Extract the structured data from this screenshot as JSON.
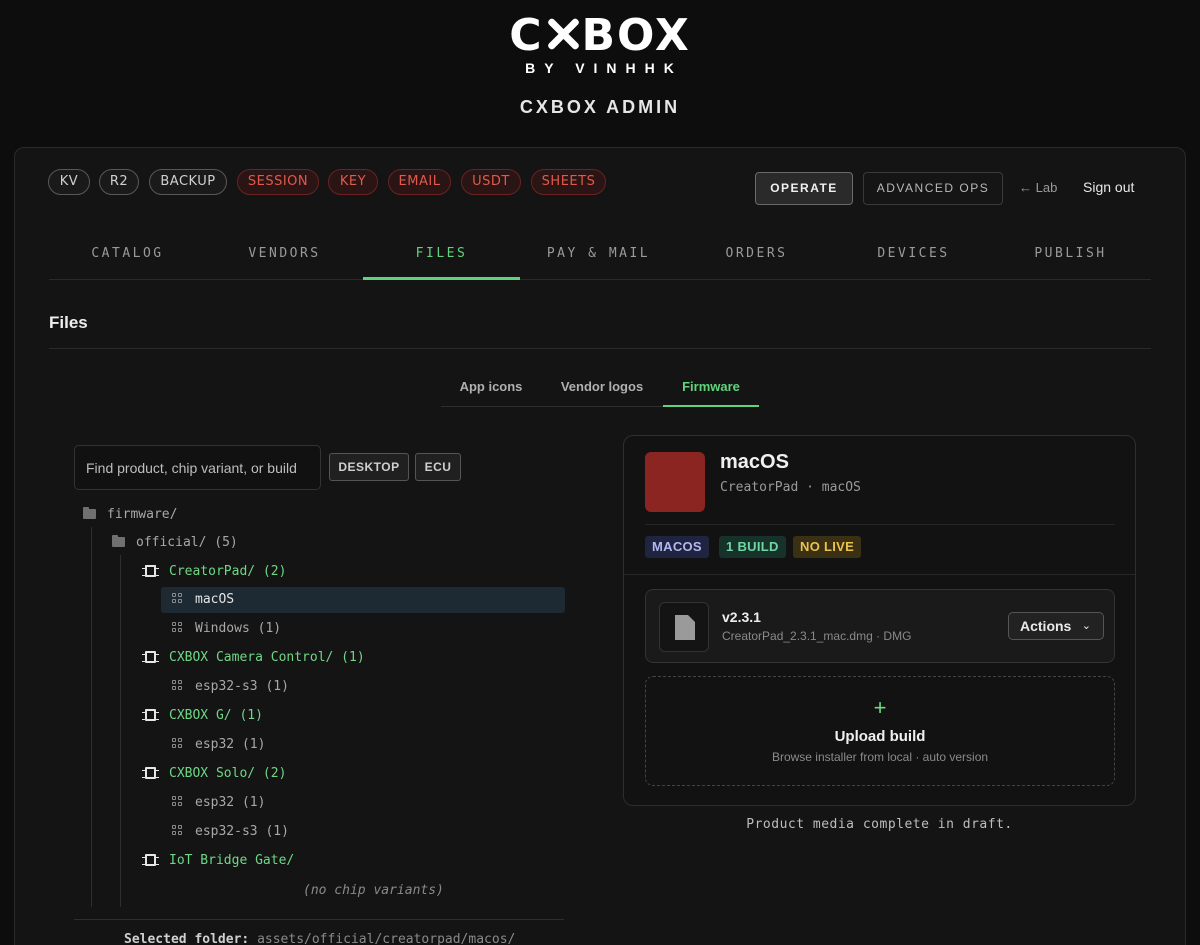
{
  "brand": {
    "logo_left": "C",
    "logo_right": "BOX",
    "logo_sub": "BY VINHHK",
    "admin_title": "CXBOX ADMIN"
  },
  "status_pills": [
    {
      "label": "KV",
      "tone": "neutral"
    },
    {
      "label": "R2",
      "tone": "neutral"
    },
    {
      "label": "BACKUP",
      "tone": "neutral"
    },
    {
      "label": "SESSION",
      "tone": "alert"
    },
    {
      "label": "KEY",
      "tone": "alert"
    },
    {
      "label": "EMAIL",
      "tone": "alert"
    },
    {
      "label": "USDT",
      "tone": "alert"
    },
    {
      "label": "SHEETS",
      "tone": "alert"
    }
  ],
  "toolbar": {
    "operate_label": "OPERATE",
    "advanced_label": "ADVANCED OPS",
    "lab_label": "← Lab",
    "signout_label": "Sign out"
  },
  "nav": {
    "tabs": [
      "CATALOG",
      "VENDORS",
      "FILES",
      "PAY & MAIL",
      "ORDERS",
      "DEVICES",
      "PUBLISH"
    ],
    "active": "FILES"
  },
  "section": {
    "title": "Files"
  },
  "subtabs": {
    "items": [
      "App icons",
      "Vendor logos",
      "Firmware"
    ],
    "active": "Firmware"
  },
  "search": {
    "placeholder": "Find product, chip variant, or build",
    "value": ""
  },
  "filters": [
    "DESKTOP",
    "ECU"
  ],
  "tree": {
    "root": "firmware/",
    "folder": "official/ (5)",
    "products": [
      {
        "label": "CreatorPad/ (2)",
        "variants": [
          "macOS",
          "Windows (1)"
        ]
      },
      {
        "label": "CXBOX Camera Control/ (1)",
        "variants": [
          "esp32-s3 (1)"
        ]
      },
      {
        "label": "CXBOX G/ (1)",
        "variants": [
          "esp32 (1)"
        ]
      },
      {
        "label": "CXBOX Solo/ (2)",
        "variants": [
          "esp32 (1)",
          "esp32-s3 (1)"
        ]
      },
      {
        "label": "IoT Bridge Gate/",
        "variants": []
      }
    ],
    "empty_label": "(no chip variants)",
    "selected_variant": "macOS"
  },
  "selected_folder": {
    "label": "Selected folder:",
    "path": "assets/official/creatorpad/macos/"
  },
  "detail": {
    "title": "macOS",
    "subtitle": "CreatorPad · macOS",
    "swatch_color": "#8a2522",
    "badges": [
      {
        "label": "MACOS",
        "tone": "blue"
      },
      {
        "label": "1 BUILD",
        "tone": "green"
      },
      {
        "label": "NO LIVE",
        "tone": "yellow"
      }
    ],
    "build": {
      "version": "v2.3.1",
      "meta": "CreatorPad_2.3.1_mac.dmg · DMG",
      "actions_label": "Actions"
    },
    "upload": {
      "plus": "+",
      "title": "Upload build",
      "subtitle": "Browse installer from local · auto version"
    }
  },
  "media_status": "Product media complete in draft.",
  "colors": {
    "accent": "#5fd47c",
    "alert": "#e05a4d",
    "background": "#0d0d0d"
  }
}
